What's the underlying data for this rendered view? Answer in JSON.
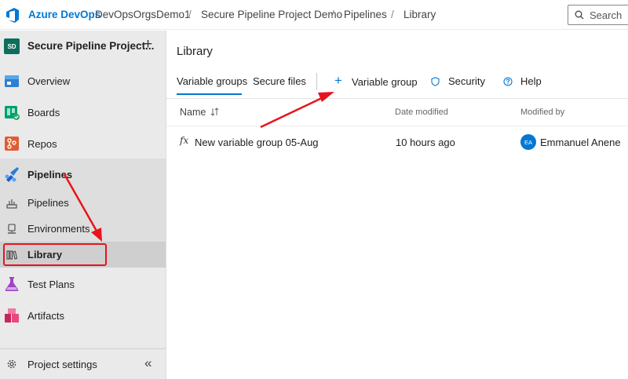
{
  "header": {
    "brand": "Azure DevOps",
    "breadcrumbs": [
      "DevOpsOrgsDemo1",
      "Secure Pipeline Project Demo",
      "Pipelines",
      "Library"
    ],
    "separator": "/",
    "search_placeholder": "Search"
  },
  "sidebar": {
    "project_initials": "SD",
    "project_name": "Secure Pipeline Project...",
    "add_label": "+",
    "items": [
      {
        "label": "Overview",
        "icon": "overview-icon"
      },
      {
        "label": "Boards",
        "icon": "boards-icon"
      },
      {
        "label": "Repos",
        "icon": "repos-icon"
      },
      {
        "label": "Pipelines",
        "icon": "pipelines-icon"
      },
      {
        "label": "Test Plans",
        "icon": "test-plans-icon"
      },
      {
        "label": "Artifacts",
        "icon": "artifacts-icon"
      }
    ],
    "pipelines_sub": [
      {
        "label": "Pipelines",
        "icon": "pipelines-sub-icon"
      },
      {
        "label": "Environments",
        "icon": "environments-icon"
      },
      {
        "label": "Library",
        "icon": "library-icon"
      }
    ],
    "settings_label": "Project settings",
    "collapse_label": "«"
  },
  "main": {
    "title": "Library",
    "tabs": [
      "Variable groups",
      "Secure files"
    ],
    "actions": [
      {
        "label": "Variable group",
        "icon": "plus-icon"
      },
      {
        "label": "Security",
        "icon": "shield-icon"
      },
      {
        "label": "Help",
        "icon": "help-icon"
      }
    ],
    "columns": {
      "name": "Name",
      "date": "Date modified",
      "modified_by": "Modified by"
    },
    "rows": [
      {
        "icon_text": "fx",
        "name": "New variable group 05-Aug",
        "date": "10 hours ago",
        "avatar": "EA",
        "modified_by": "Emmanuel Anene"
      }
    ]
  },
  "colors": {
    "accent": "#0078d4",
    "annotation": "#e8141c"
  }
}
